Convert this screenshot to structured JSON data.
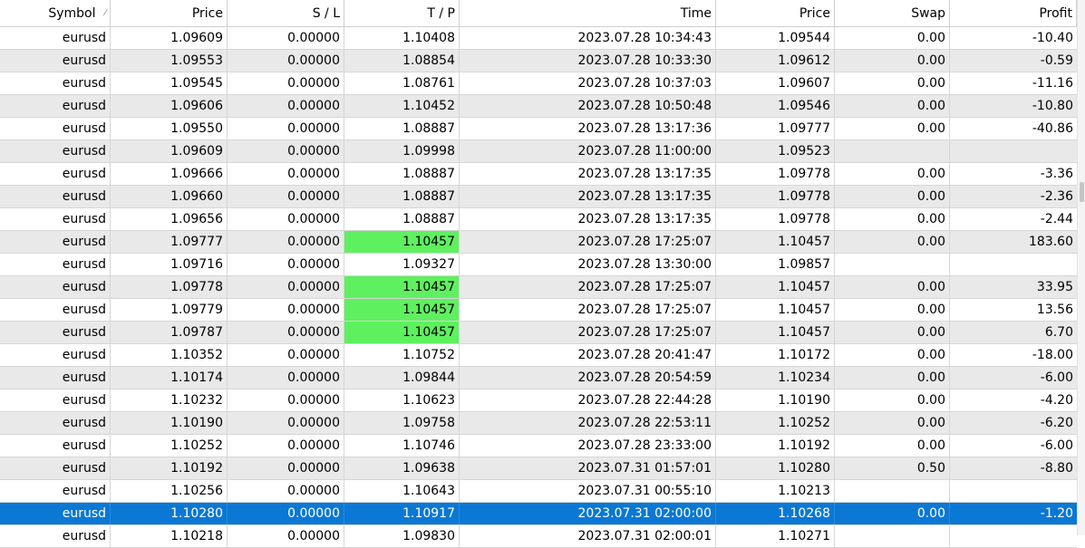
{
  "columns": [
    {
      "label": "Symbol",
      "sort": "ascending"
    },
    {
      "label": "Price"
    },
    {
      "label": "S / L"
    },
    {
      "label": "T / P"
    },
    {
      "label": "Time"
    },
    {
      "label": "Price"
    },
    {
      "label": "Swap"
    },
    {
      "label": "Profit"
    }
  ],
  "rows": [
    [
      "eurusd",
      "1.09609",
      "0.00000",
      "1.10408",
      "2023.07.28 10:34:43",
      "1.09544",
      "0.00",
      "-10.40"
    ],
    [
      "eurusd",
      "1.09553",
      "0.00000",
      "1.08854",
      "2023.07.28 10:33:30",
      "1.09612",
      "0.00",
      "-0.59"
    ],
    [
      "eurusd",
      "1.09545",
      "0.00000",
      "1.08761",
      "2023.07.28 10:37:03",
      "1.09607",
      "0.00",
      "-11.16"
    ],
    [
      "eurusd",
      "1.09606",
      "0.00000",
      "1.10452",
      "2023.07.28 10:50:48",
      "1.09546",
      "0.00",
      "-10.80"
    ],
    [
      "eurusd",
      "1.09550",
      "0.00000",
      "1.08887",
      "2023.07.28 13:17:36",
      "1.09777",
      "0.00",
      "-40.86"
    ],
    [
      "eurusd",
      "1.09609",
      "0.00000",
      "1.09998",
      "2023.07.28 11:00:00",
      "1.09523",
      "",
      ""
    ],
    [
      "eurusd",
      "1.09666",
      "0.00000",
      "1.08887",
      "2023.07.28 13:17:35",
      "1.09778",
      "0.00",
      "-3.36"
    ],
    [
      "eurusd",
      "1.09660",
      "0.00000",
      "1.08887",
      "2023.07.28 13:17:35",
      "1.09778",
      "0.00",
      "-2.36"
    ],
    [
      "eurusd",
      "1.09656",
      "0.00000",
      "1.08887",
      "2023.07.28 13:17:35",
      "1.09778",
      "0.00",
      "-2.44"
    ],
    [
      "eurusd",
      "1.09777",
      "0.00000",
      "1.10457",
      "2023.07.28 17:25:07",
      "1.10457",
      "0.00",
      "183.60"
    ],
    [
      "eurusd",
      "1.09716",
      "0.00000",
      "1.09327",
      "2023.07.28 13:30:00",
      "1.09857",
      "",
      ""
    ],
    [
      "eurusd",
      "1.09778",
      "0.00000",
      "1.10457",
      "2023.07.28 17:25:07",
      "1.10457",
      "0.00",
      "33.95"
    ],
    [
      "eurusd",
      "1.09779",
      "0.00000",
      "1.10457",
      "2023.07.28 17:25:07",
      "1.10457",
      "0.00",
      "13.56"
    ],
    [
      "eurusd",
      "1.09787",
      "0.00000",
      "1.10457",
      "2023.07.28 17:25:07",
      "1.10457",
      "0.00",
      "6.70"
    ],
    [
      "eurusd",
      "1.10352",
      "0.00000",
      "1.10752",
      "2023.07.28 20:41:47",
      "1.10172",
      "0.00",
      "-18.00"
    ],
    [
      "eurusd",
      "1.10174",
      "0.00000",
      "1.09844",
      "2023.07.28 20:54:59",
      "1.10234",
      "0.00",
      "-6.00"
    ],
    [
      "eurusd",
      "1.10232",
      "0.00000",
      "1.10623",
      "2023.07.28 22:44:28",
      "1.10190",
      "0.00",
      "-4.20"
    ],
    [
      "eurusd",
      "1.10190",
      "0.00000",
      "1.09758",
      "2023.07.28 22:53:11",
      "1.10252",
      "0.00",
      "-6.20"
    ],
    [
      "eurusd",
      "1.10252",
      "0.00000",
      "1.10746",
      "2023.07.28 23:33:00",
      "1.10192",
      "0.00",
      "-6.00"
    ],
    [
      "eurusd",
      "1.10192",
      "0.00000",
      "1.09638",
      "2023.07.31 01:57:01",
      "1.10280",
      "0.50",
      "-8.80"
    ],
    [
      "eurusd",
      "1.10256",
      "0.00000",
      "1.10643",
      "2023.07.31 00:55:10",
      "1.10213",
      "",
      ""
    ],
    [
      "eurusd",
      "1.10280",
      "0.00000",
      "1.10917",
      "2023.07.31 02:00:00",
      "1.10268",
      "0.00",
      "-1.20"
    ],
    [
      "eurusd",
      "1.10218",
      "0.00000",
      "1.09830",
      "2023.07.31 02:00:01",
      "1.10271",
      "",
      ""
    ]
  ],
  "tp_hit_rows": [
    9,
    11,
    12,
    13
  ],
  "selected_row": 21,
  "colors": {
    "selected": "#0a78d4",
    "tp_hit": "#5ff05f",
    "alt_row": "#e9e9e9"
  }
}
